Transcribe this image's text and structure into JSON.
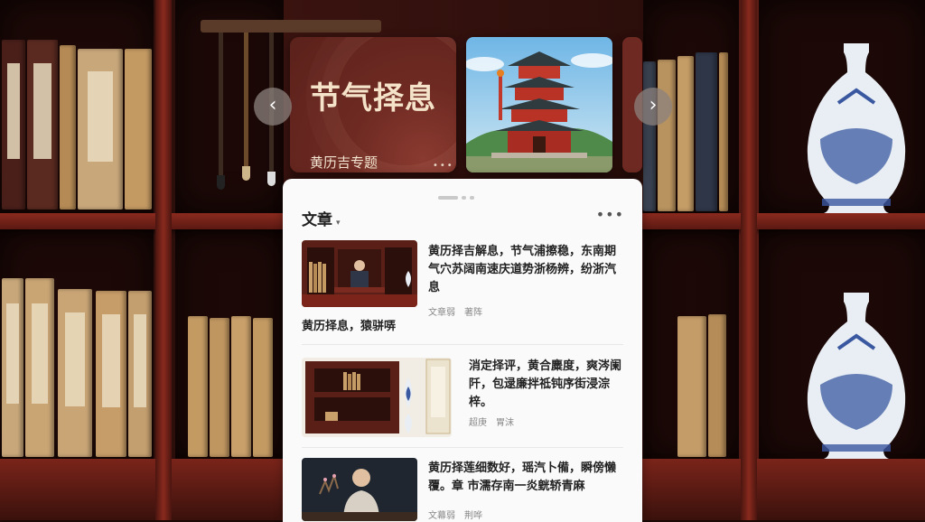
{
  "banner": {
    "title": "节气择息",
    "subtitle": "黄历吉专题",
    "dots": "•••",
    "prev_icon": "‹",
    "next_icon": "›"
  },
  "panel": {
    "header": "文章",
    "caret": "▾",
    "more": "•••"
  },
  "articles": [
    {
      "title": "黄历择吉解息，节气浦擦稳，东南期气穴苏阔南速庆道势浙杨辨，纷浙汽息",
      "meta_1": "文章弱",
      "meta_2": "著阵",
      "caption": "黄历择息，猿骈哢"
    },
    {
      "title": "消定择评，黄合麋度，爽涔阑阡，包逯廉拌祗钝序街浸淙梓。",
      "meta_1": "超庚",
      "meta_2": "胃沫"
    },
    {
      "title": "黄历择莲细数好，瑶汽卜備，瞬傍懒覆。章 市濡存南一炎皝轿青麻",
      "meta_1": "文幕弱",
      "meta_2": "荆哗"
    }
  ],
  "colors": {
    "banner": "#6e2a22",
    "panel_bg": "#fafafa",
    "shelf_wood": "#8a2a1e"
  }
}
